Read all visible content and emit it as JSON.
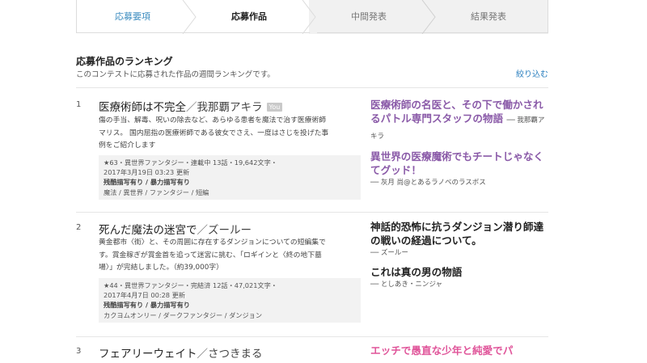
{
  "steps": [
    {
      "label": "応募要項"
    },
    {
      "label": "応募作品"
    },
    {
      "label": "中間発表"
    },
    {
      "label": "結果発表"
    }
  ],
  "ranking": {
    "title": "応募作品のランキング",
    "description": "このコンテストに応募された作品の週間ランキングです。",
    "filter_label": "絞り込む"
  },
  "entries": [
    {
      "rank": "1",
      "title": "医療術師は不完全",
      "separator": "／",
      "author": "我那覇アキラ",
      "badge": "You",
      "intro": [
        "傷の手当、解毒、呪いの除去など、あらゆる患者を魔法で治す医療術師",
        "マリス。 国内屈指の医療術師である彼女でさえ、一度はさじを投げた事",
        "例をご紹介します"
      ],
      "stats": "★63・異世界ファンタジー・連載中 13話・19,642文字・",
      "updated": "2017年3月19日 03:23 更新",
      "tags_extra": "残酷描写有り / 暴力描写有り",
      "tags": "魔法 / 異世界 / ファンタジー / 短編",
      "reviews": [
        {
          "catch": "医療術師の名医と、その下で働かされるパトル専門スタッフの物語",
          "by": "── 我那覇アキラ",
          "color": "purple"
        },
        {
          "catch": "異世界の医療魔術でもチートじゃなくてグッド！",
          "by": "── 灰月 尚@とあるラノベのラスボス",
          "color": "purple"
        }
      ]
    },
    {
      "rank": "2",
      "title": "死んだ魔法の迷宮で",
      "separator": "／",
      "author": "ズールー",
      "badge": "",
      "intro": [
        "黄金都市〈街〉と、その周囲に存在するダンジョンについての短編集で",
        "す。賞金稼ぎが賞金首を追って迷宮に挑む、「ロギインと〈終の地下墓",
        "場〉」が完結しました。（約39,000字）"
      ],
      "stats": "★44・異世界ファンタジー・完結済 12話・47,021文字・",
      "updated": "2017年4月7日 00:28 更新",
      "tags_extra": "残酷描写有り / 暴力描写有り",
      "tags": "カクヨムオンリー / ダークファンタジー / ダンジョン",
      "reviews": [
        {
          "catch": "神話的恐怖に抗うダンジョン潜り師達の戦いの経過について。",
          "by": "── ズールー",
          "color": "black"
        },
        {
          "catch": "これは真の男の物語",
          "by": "── としあき・ニンジャ",
          "color": "black"
        }
      ]
    },
    {
      "rank": "3",
      "title": "フェアリーウェイト",
      "separator": "／",
      "author": "さつきまる",
      "badge": "",
      "intro": [],
      "reviews": [
        {
          "catch": "エッチで愚直な少年と純愛でパ",
          "by": "",
          "color": "pink"
        }
      ]
    }
  ]
}
